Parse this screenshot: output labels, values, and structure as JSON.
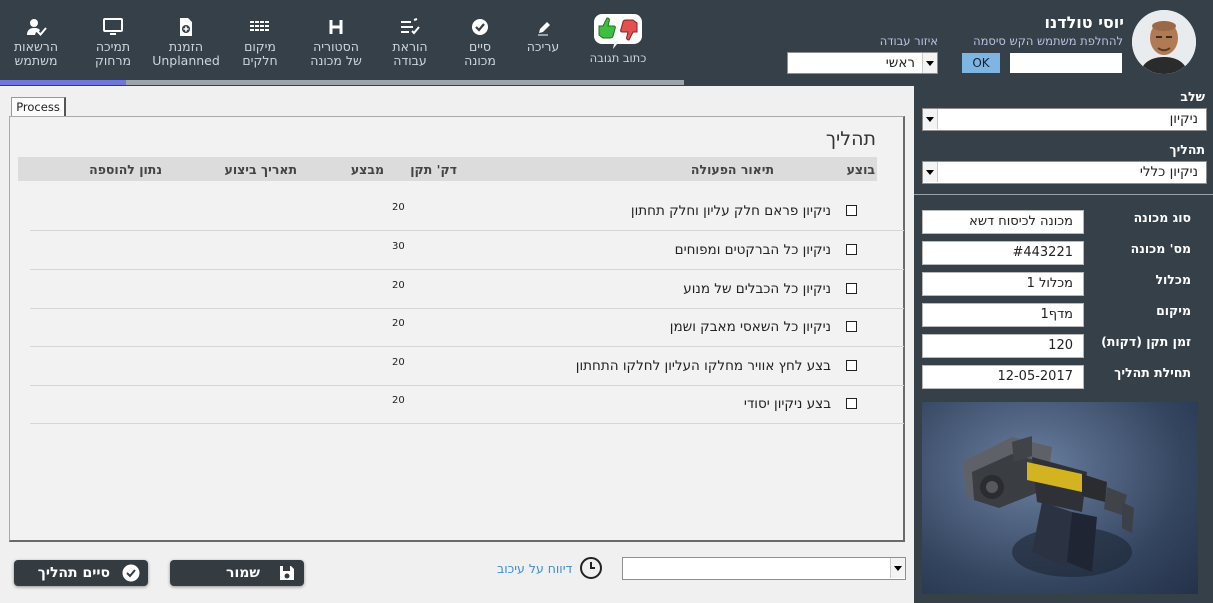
{
  "nav": [
    {
      "label": "הרשאות\nמשתמש",
      "icon": "user-check-icon",
      "key": "permissions"
    },
    {
      "label": "תמיכה\nמרחוק",
      "icon": "monitor-icon",
      "key": "remote"
    },
    {
      "label": "הזמנת\nUnplanned",
      "icon": "file-add-icon",
      "key": "order"
    },
    {
      "label": "מיקום\nחלקים",
      "icon": "grid-list-icon",
      "key": "parts"
    },
    {
      "label": "הסטוריה\nשל מכונה",
      "icon": "letter-h-icon",
      "key": "history"
    },
    {
      "label": "הוראת\nעבודה",
      "icon": "checklist-icon",
      "key": "instructions"
    },
    {
      "label": "סיים\nמכונה",
      "icon": "check-circle-icon",
      "key": "finish-machine"
    },
    {
      "label": "עריכה",
      "icon": "pencil-icon",
      "key": "edit"
    }
  ],
  "feedback_label": "כתוב תגובה",
  "work_area": {
    "label": "איזור עבודה",
    "value": "ראשי"
  },
  "user": {
    "name": "יוסי טולדנו",
    "switch_text": "להחלפת משתמש הקש סיסמה",
    "ok_label": "OK",
    "password_value": ""
  },
  "stage": {
    "label": "שלב",
    "value": "ניקיון"
  },
  "process_select": {
    "label": "תהליך",
    "value": "ניקיון כללי"
  },
  "machine": [
    {
      "label": "סוג מכונה",
      "value": "מכונה לכיסוח דשא"
    },
    {
      "label": "מס' מכונה",
      "value": "#443221"
    },
    {
      "label": "מכלול",
      "value": "מכלול 1"
    },
    {
      "label": "מיקום",
      "value": "מדף1"
    },
    {
      "label": "זמן תקן (דקות)",
      "value": "120"
    },
    {
      "label": "תחילת תהליך",
      "value": "12-05-2017"
    }
  ],
  "tab_label": "Process",
  "process_title": "תהליך",
  "table": {
    "headers": {
      "done": "בוצע",
      "desc": "תיאור הפעולה",
      "minutes": "דק' תקן",
      "performer": "מבצע",
      "date": "תאריך ביצוע",
      "extra": "נתון להוספה"
    },
    "rows": [
      {
        "desc": "ניקיון פראם חלק עליון וחלק תחתון",
        "minutes": "20"
      },
      {
        "desc": "ניקיון כל הברקטים ומפוחים",
        "minutes": "30"
      },
      {
        "desc": "ניקיון כל הכבלים של מנוע",
        "minutes": "20"
      },
      {
        "desc": "ניקיון כל השאסי מאבק ושמן",
        "minutes": "20"
      },
      {
        "desc": "בצע לחץ אוויר מחלקו העליון לחלקו התחתון",
        "minutes": "20"
      },
      {
        "desc": "בצע ניקיון יסודי",
        "minutes": "20"
      }
    ]
  },
  "delay_label": "דיווח על עיכוב",
  "delay_value": "",
  "buttons": {
    "finish": "סיים תהליך",
    "save": "שמור"
  }
}
